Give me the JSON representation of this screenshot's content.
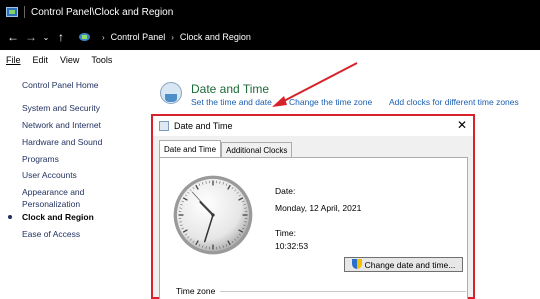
{
  "window": {
    "title": "Control Panel\\Clock and Region"
  },
  "address": {
    "crumbs": [
      "Control Panel",
      "Clock and Region"
    ]
  },
  "menu": {
    "items": [
      "File",
      "Edit",
      "View",
      "Tools"
    ]
  },
  "sidebar": {
    "items": [
      {
        "label": "Control Panel Home",
        "active": false
      },
      {
        "label": "System and Security",
        "active": false
      },
      {
        "label": "Network and Internet",
        "active": false
      },
      {
        "label": "Hardware and Sound",
        "active": false
      },
      {
        "label": "Programs",
        "active": false
      },
      {
        "label": "User Accounts",
        "active": false
      },
      {
        "label": "Appearance and",
        "active": false
      },
      {
        "label": "Personalization",
        "active": false
      },
      {
        "label": "Clock and Region",
        "active": true
      },
      {
        "label": "Ease of Access",
        "active": false
      }
    ]
  },
  "section": {
    "title": "Date and Time",
    "links": [
      "Set the time and date",
      "Change the time zone",
      "Add clocks for different time zones"
    ]
  },
  "dialog": {
    "title": "Date and Time",
    "close": "✕",
    "tabs": [
      {
        "label": "Date and Time",
        "active": true
      },
      {
        "label": "Additional Clocks",
        "active": false
      }
    ],
    "date_label": "Date:",
    "date_value": "Monday, 12 April, 2021",
    "time_label": "Time:",
    "time_value": "10:32:53",
    "change_button": "Change date and time...",
    "timezone_label": "Time zone",
    "clock": {
      "hour": 10,
      "minute": 32,
      "second": 53
    }
  },
  "colors": {
    "annotation_red": "#d6222a",
    "link_blue": "#1a5fb4",
    "section_title_green": "#1d6a3a"
  },
  "icons": {
    "back": "arrow-left-icon",
    "forward": "arrow-right-icon",
    "up": "arrow-up-icon",
    "control_panel": "control-panel-icon",
    "section": "date-time-icon",
    "uac": "shield-icon"
  }
}
